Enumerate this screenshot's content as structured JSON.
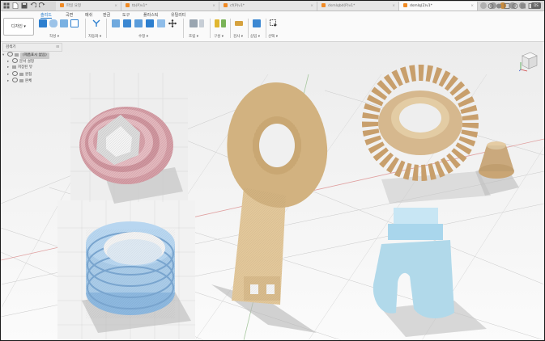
{
  "tabs": [
    {
      "label": "파일 요정"
    },
    {
      "label": "tb(P)v1*"
    },
    {
      "label": "cf(P)v1*"
    },
    {
      "label": "dsmlqbd(P)v1*"
    },
    {
      "label": "dsmlq(2)v1*"
    }
  ],
  "user": {
    "initials": "DS"
  },
  "toolbar": {
    "workspace": "디자인 ▾",
    "ribbon_tabs": [
      "솔리드",
      "곡면",
      "메쉬",
      "판금",
      "도구",
      "플라스틱",
      "유틸리티"
    ],
    "groups": [
      "작성 ▾",
      "자동화 ▾",
      "수정 ▾",
      "조립 ▾",
      "구성 ▾",
      "검사 ▾",
      "삽입 ▾",
      "선택 ▾"
    ]
  },
  "browser": {
    "title": "검색기",
    "root": "(제품표시 없음)",
    "items": [
      "문서 설정",
      "저장된 뷰",
      "원점",
      "본체"
    ]
  },
  "colors": {
    "pink": "#e3b6bc",
    "tan": "#e2c79a",
    "blue": "#a9cbe8",
    "gear": "#dbbd92",
    "cyan": "#b5def0",
    "accent": "#1a74c9"
  }
}
